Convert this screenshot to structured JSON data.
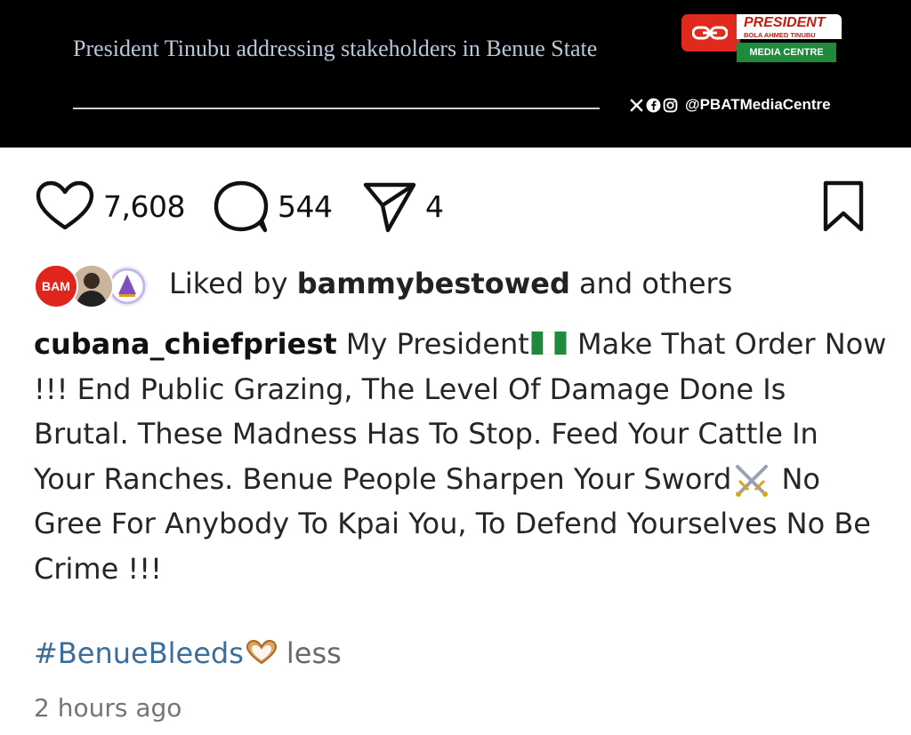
{
  "banner": {
    "caption": "President Tinubu addressing stakeholders in Benue State",
    "logo": {
      "word": "PRESIDENT",
      "sub": "BOLA AHMED TINUBU",
      "bar": "MEDIA CENTRE"
    },
    "social_icons": [
      "x-icon",
      "facebook-icon",
      "instagram-icon"
    ],
    "social_handle": "@PBATMediaCentre"
  },
  "actions": {
    "likes": "7,608",
    "comments": "544",
    "shares": "4"
  },
  "liked_by": {
    "prefix": "Liked by ",
    "user": "bammybestowed",
    "suffix": " and others",
    "avatar1_text": "BAM"
  },
  "post": {
    "username": "cubana_chiefpriest",
    "line1a": " My President",
    "line1b": " Make That Order Now !!! End Public Grazing, The Level Of Damage Done Is Brutal. These Madness Has To Stop. Feed Your Cattle In Your Ranches. Benue People Sharpen Your Sword",
    "line1c": " No Gree For Anybody To Kpai You, To Defend Yourselves No Be Crime !!!",
    "hashtag": "#BenueBleeds",
    "less": "less",
    "timestamp": "2 hours ago"
  },
  "colors": {
    "banner_bg": "#000000",
    "caption": "#b8c8dc",
    "logo_red": "#e02a1d",
    "logo_green": "#1f8a3c",
    "hashtag": "#3a6e9e",
    "muted": "#757575"
  }
}
